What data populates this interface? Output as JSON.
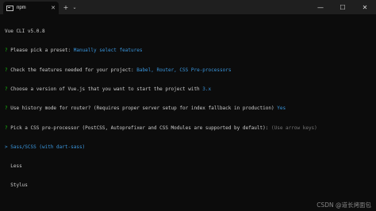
{
  "window": {
    "tab_title": "npm",
    "tab_close": "✕",
    "new_tab": "+",
    "dropdown": "⌄",
    "minimize": "—",
    "maximize": "☐",
    "close": "✕"
  },
  "terminal": {
    "version": "Vue CLI v5.0.8",
    "q_mark": "?",
    "preset_q": "Please pick a preset:",
    "preset_a": "Manually select features",
    "features_q": "Check the features needed for your project:",
    "features_a": "Babel, Router, CSS Pre-processors",
    "vue_q": "Choose a version of Vue.js that you want to start the project with",
    "vue_a": "3.x",
    "history_q": "Use history mode for router? (Requires proper server setup for index fallback in production)",
    "history_a": "Yes",
    "css_q": "Pick a CSS pre-processor (PostCSS, Autoprefixer and CSS Modules are supported by default):",
    "css_hint": "(Use arrow keys)",
    "pointer": ">",
    "options": [
      "Sass/SCSS (with dart-sass)",
      "Less",
      "Stylus"
    ]
  },
  "watermark": "CSDN @道长烤面包",
  "colors": {
    "background": "#0c0c0c",
    "titlebar": "#1f1f1f",
    "question_mark": "#16c60c",
    "answer": "#3a96dd",
    "hint": "#767676",
    "text": "#cccccc"
  }
}
